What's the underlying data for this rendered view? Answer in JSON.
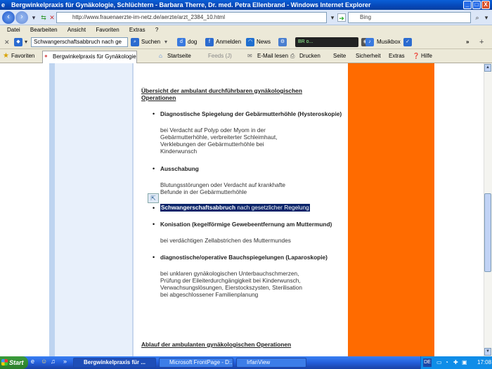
{
  "window": {
    "title": "Bergwinkelpraxis für Gynäkologie, Schlüchtern - Barbara Therre, Dr. med. Petra Ellenbrand - Windows Internet Explorer",
    "min": "_",
    "max": "□",
    "close": "X"
  },
  "address": {
    "url": "http://www.frauenaerzte-im-netz.de/aerzte/arzt_2384_10.html"
  },
  "search": {
    "placeholder": "Bing"
  },
  "menu": {
    "items": [
      "Datei",
      "Bearbeiten",
      "Ansicht",
      "Favoriten",
      "Extras",
      "?"
    ]
  },
  "toolbar": {
    "search_combo": "Schwangerschaftsabbruch  nach ge",
    "suchen": "Suchen",
    "dog": "dog",
    "anmelden": "Anmelden",
    "news": "News",
    "radio": "BR o...",
    "musikbox": "Musikbox"
  },
  "favbar": {
    "favoriten": "Favoriten",
    "tab": "Bergwinkelpraxis für Gynäkologie...",
    "startseite": "Startseite",
    "feeds": "Feeds (J)",
    "email": "E-Mail lesen",
    "drucken": "Drucken",
    "seite": "Seite",
    "sicherheit": "Sicherheit",
    "extras": "Extras",
    "hilfe": "Hilfe"
  },
  "page": {
    "heading1_line1": "Übersicht der ambulant durchführbaren gynäkologischen",
    "heading1_line2": "Operationen",
    "items": [
      {
        "title": "Diagnostische Spiegelung der Gebärmutterhöhle (Hysteroskopie)",
        "desc": [
          "bei Verdacht auf Polyp oder Myom in der",
          "Gebärmutterhöhle, verbreiterter Schleimhaut,",
          "Verklebungen  der Gebärmutterhöhle bei",
          "Kinderwunsch"
        ]
      },
      {
        "title": "Ausschabung",
        "desc": [
          "Blutungsstörungen oder Verdacht auf krankhafte",
          "Befunde in der Gebärmutterhöhle"
        ]
      },
      {
        "title_bold": "Schwangerschaftsabbruch",
        "title_rest": "  nach gesetzlicher Regelung"
      },
      {
        "title": "Konisation (kegelförmige Gewebeentfernung am Muttermund)",
        "desc": [
          "bei verdächtigen Zellabstrichen des Muttermundes"
        ]
      },
      {
        "title": "diagnostische/operative Bauchspiegelungen (Laparoskopie)",
        "desc": [
          "bei unklaren gynäkologischen Unterbauchschmerzen,",
          "Prüfung der Eileiterdurchgängigkeit bei Kinderwunsch,",
          "Verwachsungslösungen, Eierstockszysten, Sterilisation",
          "bei abgeschlossener Familienplanung"
        ]
      }
    ],
    "heading2": "Ablauf der ambulanten gynäkologischen Operationen"
  },
  "taskbar": {
    "start": "Start",
    "items": [
      "Bergwinkelpraxis für ...",
      "Microsoft FrontPage - D:...",
      "IrfanView"
    ],
    "lang": "DE",
    "clock": "17:08"
  },
  "colors": {
    "accent_orange": "#ff6b00",
    "selection": "#0a246a",
    "xp_blue": "#245edb"
  }
}
